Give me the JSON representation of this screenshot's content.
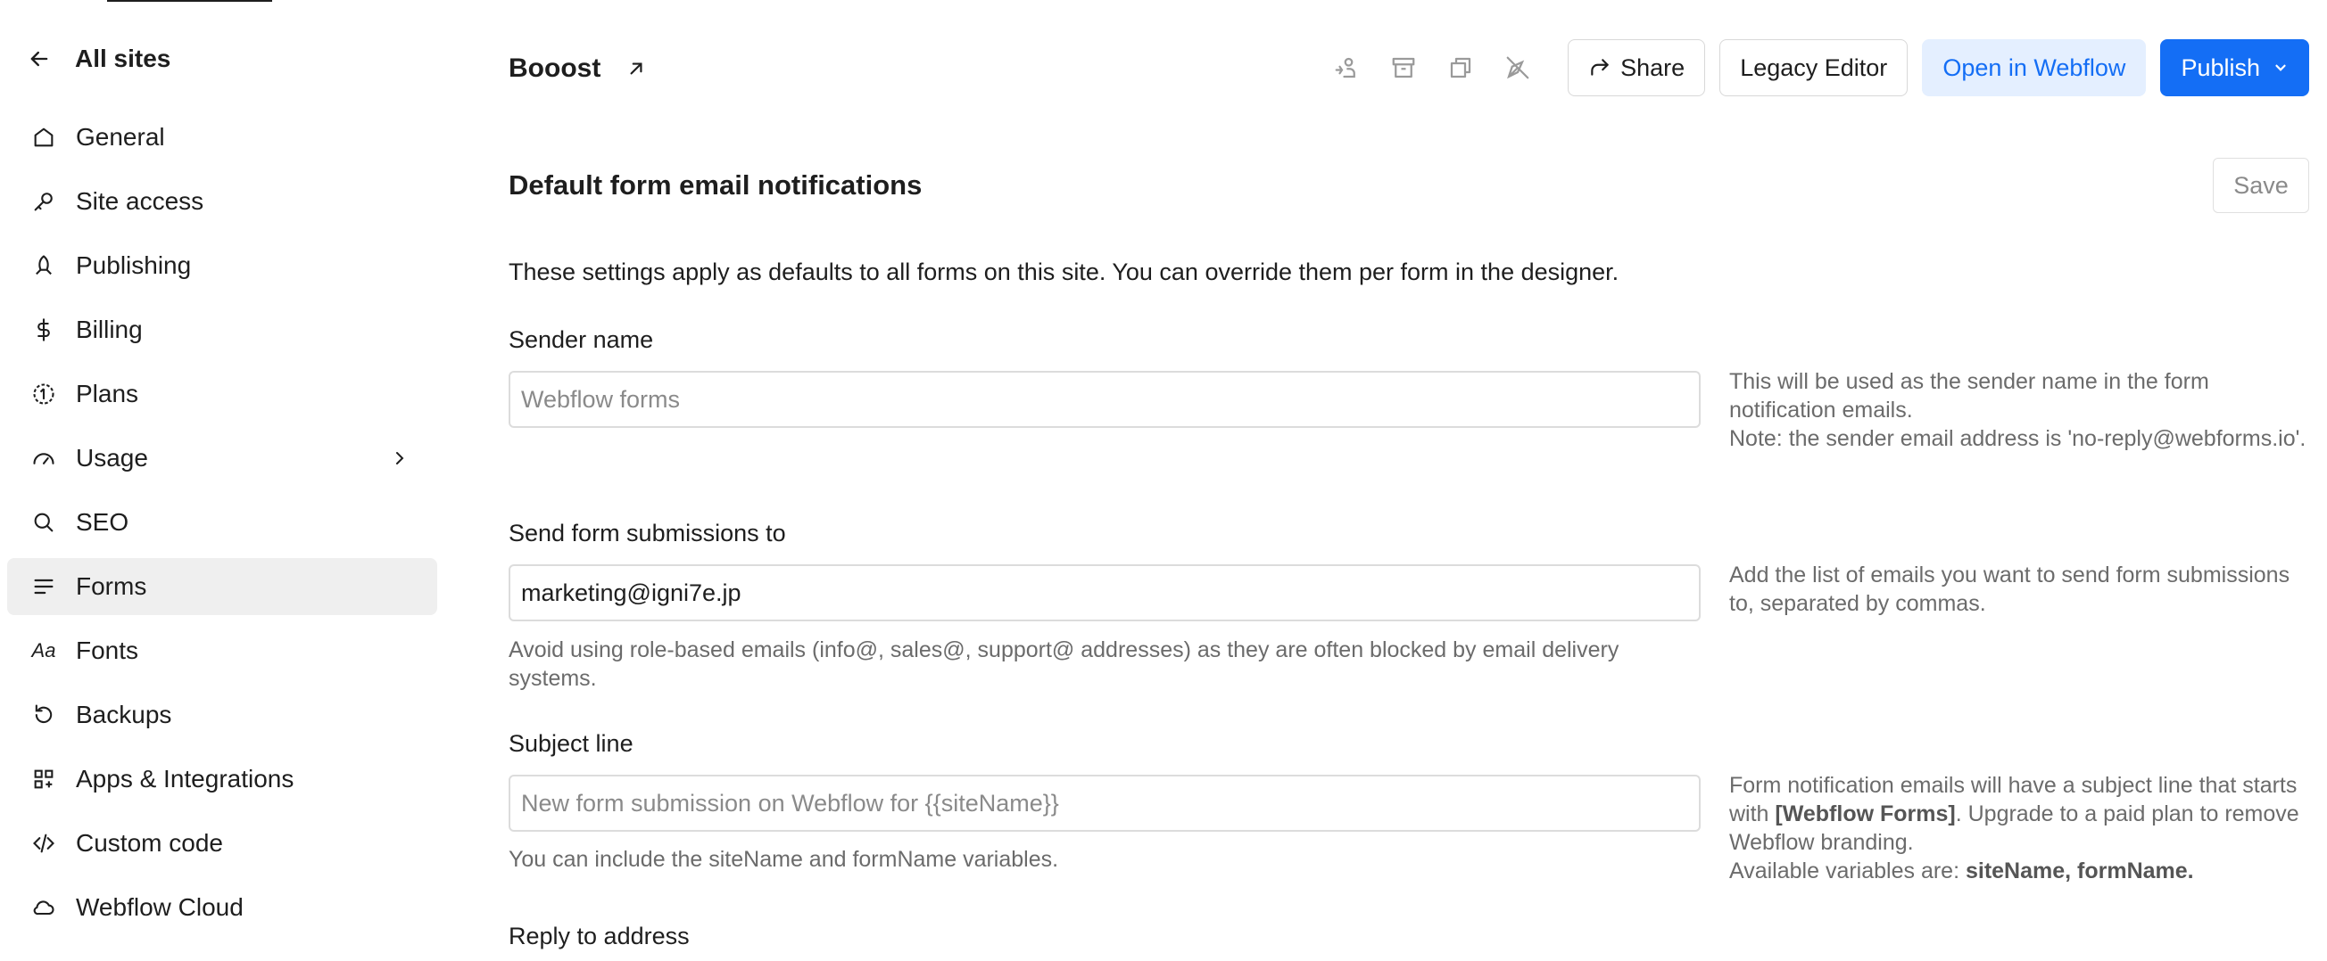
{
  "sidebar": {
    "back_label": "All sites",
    "items": [
      {
        "label": "General",
        "icon": "home-icon"
      },
      {
        "label": "Site access",
        "icon": "key-icon"
      },
      {
        "label": "Publishing",
        "icon": "rocket-icon"
      },
      {
        "label": "Billing",
        "icon": "dollar-icon"
      },
      {
        "label": "Plans",
        "icon": "plans-icon"
      },
      {
        "label": "Usage",
        "icon": "gauge-icon"
      },
      {
        "label": "SEO",
        "icon": "search-icon"
      },
      {
        "label": "Forms",
        "icon": "forms-icon"
      },
      {
        "label": "Fonts",
        "icon": "fonts-icon"
      },
      {
        "label": "Backups",
        "icon": "backup-icon"
      },
      {
        "label": "Apps & Integrations",
        "icon": "apps-icon"
      },
      {
        "label": "Custom code",
        "icon": "code-icon"
      },
      {
        "label": "Webflow Cloud",
        "icon": "cloud-icon"
      }
    ],
    "active": "Forms",
    "fonts_icon_text": "Aa"
  },
  "header": {
    "site_name": "Booost",
    "share_label": "Share",
    "legacy_label": "Legacy Editor",
    "open_label": "Open in Webflow",
    "publish_label": "Publish"
  },
  "main": {
    "section_title": "Default form email notifications",
    "save_label": "Save",
    "intro": "These settings apply as defaults to all forms on this site. You can override them per form in the designer.",
    "sender": {
      "label": "Sender name",
      "placeholder": "Webflow forms",
      "help_line1": "This will be used as the sender name in the form notification emails.",
      "help_line2": "Note: the sender email address is 'no-reply@webforms.io'."
    },
    "send_to": {
      "label": "Send form submissions to",
      "value": "marketing@igni7e.jp",
      "below_help": "Avoid using role-based emails (info@, sales@, support@ addresses) as they are often blocked by email delivery systems.",
      "side_help": "Add the list of emails you want to send form submissions to, separated by commas."
    },
    "subject": {
      "label": "Subject line",
      "placeholder": "New form submission on Webflow for {{siteName}}",
      "below_help": "You can include the siteName and formName variables.",
      "side_help_pre": "Form notification emails will have a subject line that starts with ",
      "side_help_bold": "[Webflow Forms]",
      "side_help_post": ". Upgrade to a paid plan to remove Webflow branding.",
      "vars_pre": "Available variables are: ",
      "vars_bold": "siteName, formName."
    },
    "reply_to": {
      "label": "Reply to address"
    }
  },
  "colors": {
    "accent": "#146ef5",
    "accent_light": "#e4efff",
    "active_bg": "#efefef"
  }
}
